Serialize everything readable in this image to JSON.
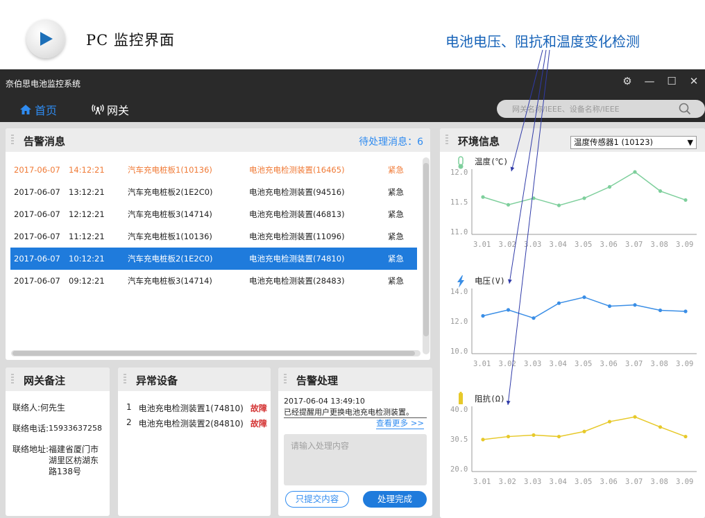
{
  "caption": {
    "title": "PC 监控界面",
    "annotation": "电池电压、阻抗和温度变化检测"
  },
  "window": {
    "title": "奈伯思电池监控系统",
    "controls": [
      "⚙",
      "—",
      "☐",
      "✕"
    ]
  },
  "nav": {
    "home": "首页",
    "gateway": "网关",
    "search_placeholder": "网关名称/IEEE、设备名称/IEEE"
  },
  "alarm": {
    "title": "告警消息",
    "pending": "待处理消息：6",
    "rows": [
      {
        "date": "2017-06-07",
        "time": "14:12:21",
        "pile": "汽车充电桩板1(10136)",
        "device": "电池充电检测装置(16465)",
        "level": "紧急",
        "state": "warn"
      },
      {
        "date": "2017-06-07",
        "time": "13:12:21",
        "pile": "汽车充电桩板2(1E2C0)",
        "device": "电池充电检测装置(94516)",
        "level": "紧急",
        "state": "normal"
      },
      {
        "date": "2017-06-07",
        "time": "12:12:21",
        "pile": "汽车充电桩板3(14714)",
        "device": "电池充电检测装置(46813)",
        "level": "紧急",
        "state": "normal"
      },
      {
        "date": "2017-06-07",
        "time": "11:12:21",
        "pile": "汽车充电桩板1(10136)",
        "device": "电池充电检测装置(11096)",
        "level": "紧急",
        "state": "normal"
      },
      {
        "date": "2017-06-07",
        "time": "10:12:21",
        "pile": "汽车充电桩板2(1E2C0)",
        "device": "电池充电检测装置(74810)",
        "level": "紧急",
        "state": "selected"
      },
      {
        "date": "2017-06-07",
        "time": "09:12:21",
        "pile": "汽车充电桩板3(14714)",
        "device": "电池充电检测装置(28483)",
        "level": "紧急",
        "state": "normal"
      }
    ]
  },
  "gateway_note": {
    "title": "网关备注",
    "contact_label": "联络人:",
    "contact_value": "何先生",
    "phone_label": "联络电话:",
    "phone_value": "15933637258",
    "address_label": "联络地址:",
    "address_value": "福建省厦门市湖里区枋湖东路138号"
  },
  "abnormal": {
    "title": "异常设备",
    "items": [
      {
        "index": "1",
        "name": "电池充电检测装置1(74810)",
        "status": "故障"
      },
      {
        "index": "2",
        "name": "电池充电检测装置2(84810)",
        "status": "故障"
      }
    ]
  },
  "handling": {
    "title": "告警处理",
    "timestamp": "2017-06-04  13:49:10",
    "message": "已经提醒用户更换电池充电检测装置。",
    "more": "查看更多  >>",
    "input_placeholder": "请输入处理内容",
    "submit_only": "只提交内容",
    "done": "处理完成"
  },
  "env": {
    "title": "环境信息",
    "sensor_selected": "温度传感器1 (10123)",
    "sensor_arrow": "▼"
  },
  "chart_data": [
    {
      "type": "line",
      "title": "温度(℃)",
      "icon": "thermometer-icon",
      "color": "#7ecf9c",
      "x": [
        "3.01",
        "3.02",
        "3.03",
        "3.04",
        "3.05",
        "3.06",
        "3.07",
        "3.08",
        "3.09"
      ],
      "yticks": [
        "12.0",
        "11.5",
        "11.0"
      ],
      "ylim": [
        11.0,
        12.0
      ],
      "values": [
        11.58,
        11.45,
        11.56,
        11.44,
        11.56,
        11.75,
        12.0,
        11.68,
        11.53
      ]
    },
    {
      "type": "line",
      "title": "电压(V)",
      "icon": "lightning-icon",
      "color": "#3a8ee6",
      "x": [
        "3.01",
        "3.02",
        "3.03",
        "3.04",
        "3.05",
        "3.06",
        "3.07",
        "3.08",
        "3.09"
      ],
      "yticks": [
        "14.0",
        "12.0",
        "10.0"
      ],
      "ylim": [
        10.0,
        14.0
      ],
      "values": [
        12.35,
        12.75,
        12.2,
        13.2,
        13.6,
        13.0,
        13.08,
        12.72,
        12.65
      ]
    },
    {
      "type": "line",
      "title": "阻抗(Ω)",
      "icon": "battery-icon",
      "color": "#e7c92a",
      "x": [
        "3.01",
        "3.02",
        "3.03",
        "3.04",
        "3.05",
        "3.06",
        "3.07",
        "3.08",
        "3.09"
      ],
      "yticks": [
        "40.0",
        "30.5",
        "20.0"
      ],
      "ylim": [
        20.0,
        40.0
      ],
      "values": [
        29.8,
        30.8,
        31.3,
        30.8,
        32.5,
        35.8,
        37.4,
        34.0,
        30.8
      ]
    }
  ]
}
